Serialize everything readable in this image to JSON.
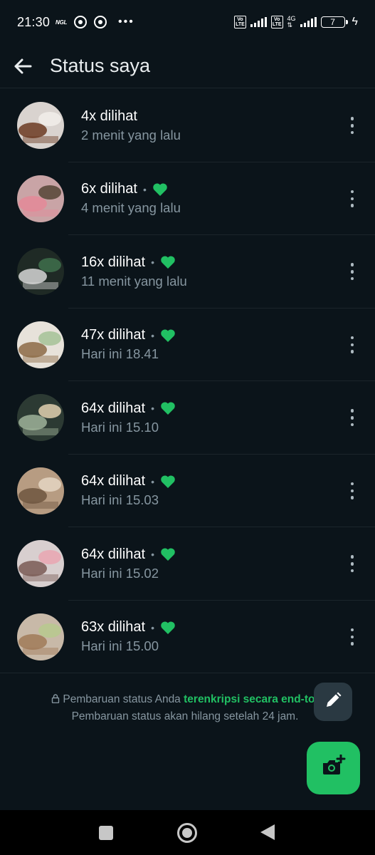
{
  "status_bar": {
    "time": "21:30",
    "carrier_tag": "NGL",
    "volte1": "Vo LTE",
    "volte2": "Vo LTE",
    "network": "4G",
    "battery_level": "7"
  },
  "header": {
    "title": "Status saya",
    "back_icon": "arrow-left-icon"
  },
  "statuses": [
    {
      "views": "4x dilihat",
      "time": "2 menit yang lalu",
      "liked": false,
      "thumb_colors": [
        "#d9d3cf",
        "#6b3a22",
        "#f0ece8"
      ]
    },
    {
      "views": "6x dilihat",
      "time": "4 menit yang lalu",
      "liked": true,
      "thumb_colors": [
        "#c9a4a6",
        "#e48a98",
        "#5b4a3c"
      ]
    },
    {
      "views": "16x dilihat",
      "time": "11 menit yang lalu",
      "liked": true,
      "thumb_colors": [
        "#1f2a25",
        "#d6d6d6",
        "#3d6b4a"
      ]
    },
    {
      "views": "47x dilihat",
      "time": "Hari ini 18.41",
      "liked": true,
      "thumb_colors": [
        "#e7e2da",
        "#8c6a45",
        "#a8c49a"
      ]
    },
    {
      "views": "64x dilihat",
      "time": "Hari ini 15.10",
      "liked": true,
      "thumb_colors": [
        "#2c3a33",
        "#9fb39a",
        "#d7c9a8"
      ]
    },
    {
      "views": "64x dilihat",
      "time": "Hari ini 15.03",
      "liked": true,
      "thumb_colors": [
        "#b79c82",
        "#6f5640",
        "#e2d3bf"
      ]
    },
    {
      "views": "64x dilihat",
      "time": "Hari ini 15.02",
      "liked": true,
      "thumb_colors": [
        "#d8cfcf",
        "#7a5a55",
        "#e9a7b2"
      ]
    },
    {
      "views": "63x dilihat",
      "time": "Hari ini 15.00",
      "liked": true,
      "thumb_colors": [
        "#c8b9a8",
        "#a07a58",
        "#b8c98f"
      ]
    }
  ],
  "separator": "•",
  "notice": {
    "text1": "Pembaruan status Anda ",
    "link": "terenkripsi secara end-to-",
    "text2": "Pembaruan status akan hilang setelah 24 jam."
  },
  "fab": {
    "pencil_icon": "pencil-icon",
    "camera_icon": "camera-plus-icon"
  },
  "colors": {
    "background": "#0b141a",
    "accent": "#21c063",
    "secondary_text": "#8696a0"
  }
}
